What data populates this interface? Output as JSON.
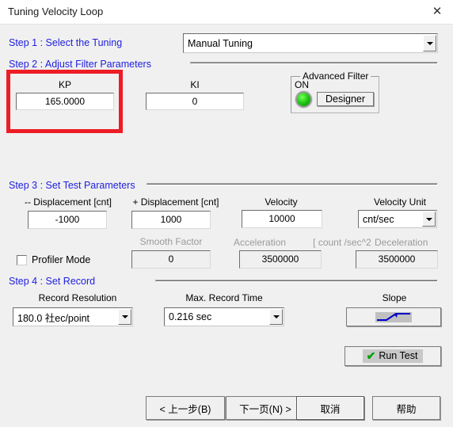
{
  "window": {
    "title": "Tuning Velocity Loop",
    "close_icon": "close-icon"
  },
  "steps": {
    "step1": {
      "label": "Step 1 : Select the  Tuning",
      "mode_select": {
        "value": "Manual Tuning",
        "arrow_icon": "chevron-down-icon"
      }
    },
    "step2": {
      "label": "Step 2 :  Adjust Filter Parameters",
      "kp": {
        "label": "KP",
        "value": "165.0000"
      },
      "ki": {
        "label": "KI",
        "value": "0"
      },
      "advanced_filter": {
        "title": "Advanced Filter",
        "state": "ON",
        "led_icon": "green-led-icon",
        "designer_button": "Designer"
      }
    },
    "step3": {
      "label": "Step 3 : Set Test  Parameters",
      "neg_displacement": {
        "label": "-- Displacement [cnt]",
        "value": "-1000"
      },
      "pos_displacement": {
        "label": "+ Displacement [cnt]",
        "value": "1000"
      },
      "velocity": {
        "label": "Velocity",
        "value": "10000"
      },
      "velocity_unit": {
        "label": "Velocity Unit",
        "value": "cnt/sec",
        "arrow_icon": "chevron-down-icon"
      },
      "profiler_mode": {
        "label": "Profiler Mode",
        "checked": false
      },
      "smooth_factor": {
        "label": "Smooth Factor",
        "value": "0"
      },
      "accel_label": "Acceleration",
      "accel_unit_label": "[ count /sec^2",
      "decel_label": "Deceleration",
      "acceleration": {
        "value": "3500000"
      },
      "deceleration": {
        "value": "3500000"
      }
    },
    "step4": {
      "label": "Step 4 : Set Record",
      "record_resolution": {
        "label": "Record Resolution",
        "value": "180.0 社ec/point",
        "arrow_icon": "chevron-down-icon"
      },
      "max_record_time": {
        "label": "Max. Record Time",
        "value": "0.216 sec",
        "arrow_icon": "chevron-down-icon"
      },
      "slope": {
        "label": "Slope",
        "button_icon": "slope-waveform-icon"
      }
    }
  },
  "run_test": {
    "label": "Run Test",
    "icon": "green-check-icon"
  },
  "footer": {
    "back": "< 上一步(B)",
    "next": "下一页(N) >",
    "cancel": "取消",
    "help": "帮助"
  },
  "colors": {
    "step_label": "#2020e0",
    "highlight": "#ee1c25",
    "led_green": "#1fc914",
    "check_green": "#00a000",
    "dialog_bg": "#f0f0f0"
  }
}
